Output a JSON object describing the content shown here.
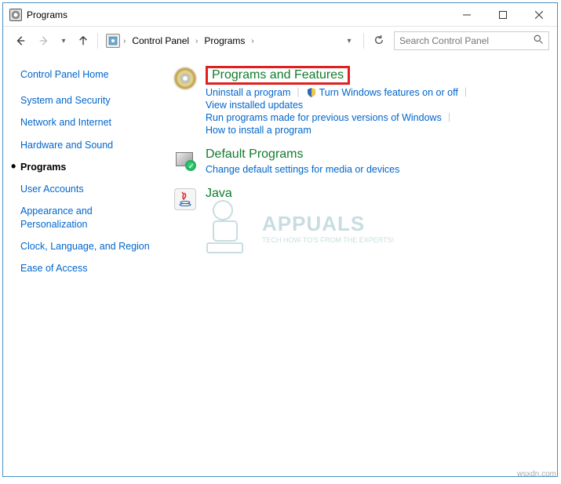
{
  "window": {
    "title": "Programs"
  },
  "nav": {
    "breadcrumb": [
      "Control Panel",
      "Programs"
    ],
    "search_placeholder": "Search Control Panel"
  },
  "sidebar": {
    "home": "Control Panel Home",
    "items": [
      {
        "label": "System and Security"
      },
      {
        "label": "Network and Internet"
      },
      {
        "label": "Hardware and Sound"
      },
      {
        "label": "Programs",
        "active": true
      },
      {
        "label": "User Accounts"
      },
      {
        "label": "Appearance and Personalization"
      },
      {
        "label": "Clock, Language, and Region"
      },
      {
        "label": "Ease of Access"
      }
    ]
  },
  "sections": {
    "programs": {
      "header": "Programs and Features",
      "links": {
        "uninstall": "Uninstall a program",
        "features": "Turn Windows features on or off",
        "updates": "View installed updates",
        "compat": "Run programs made for previous versions of Windows",
        "howto": "How to install a program"
      }
    },
    "defaults": {
      "header": "Default Programs",
      "links": {
        "change": "Change default settings for media or devices"
      }
    },
    "java": {
      "header": "Java"
    }
  },
  "watermark": {
    "brand": "APPUALS",
    "tagline": "TECH HOW-TO'S FROM THE EXPERTS!"
  },
  "footer": "wsxdn.com"
}
